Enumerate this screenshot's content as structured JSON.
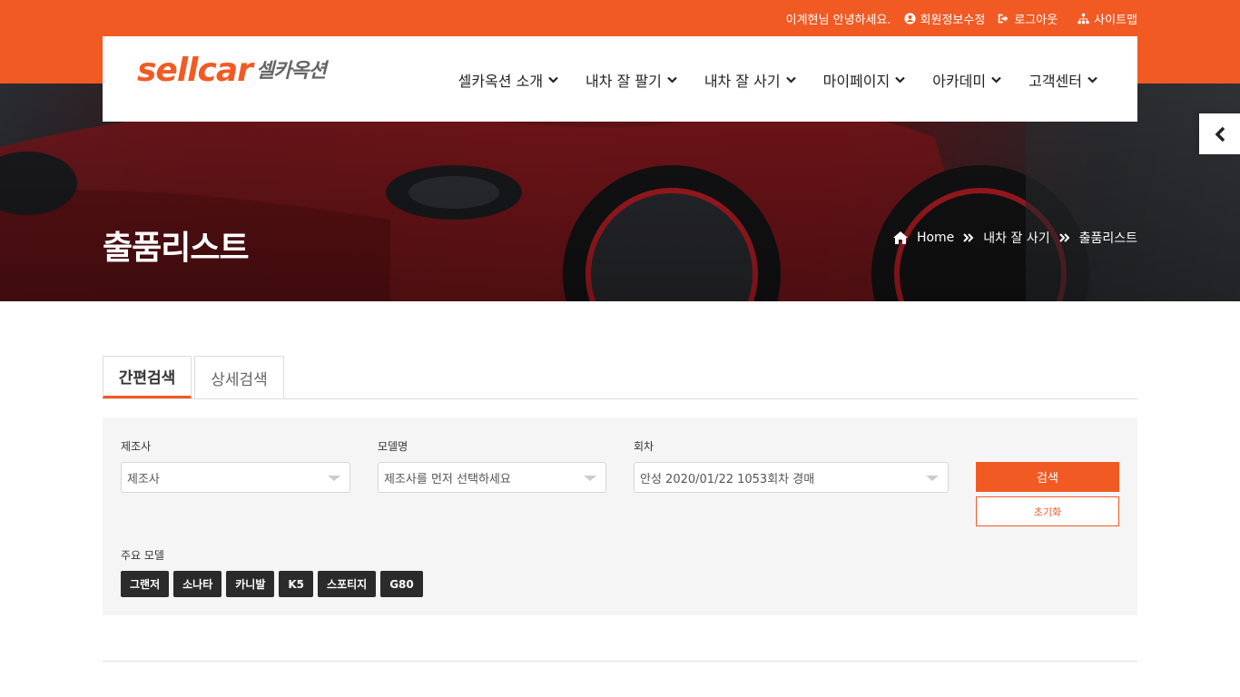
{
  "util": {
    "greeting": "이계현님 안녕하세요.",
    "links": [
      {
        "label": "회원정보수정",
        "icon": "user-circle-icon"
      },
      {
        "label": "로그아웃",
        "icon": "logout-icon"
      },
      {
        "label": "사이트맵",
        "icon": "sitemap-icon"
      }
    ]
  },
  "brand": {
    "logo_en": "sellcar",
    "logo_ko": "셀카옥션",
    "accent": "#f25a24"
  },
  "nav": {
    "items": [
      "셀카옥션 소개",
      "내차 잘 팔기",
      "내차 잘 사기",
      "마이페이지",
      "아카데미",
      "고객센터"
    ]
  },
  "hero": {
    "title": "출품리스트",
    "breadcrumb": [
      "Home",
      "내차 잘 사기",
      "출품리스트"
    ]
  },
  "tabs": {
    "active": "간편검색",
    "inactive": "상세검색"
  },
  "search": {
    "maker_label": "제조사",
    "maker_value": "제조사",
    "model_label": "모델명",
    "model_value": "제조사를 먼저 선택하세요",
    "round_label": "회차",
    "round_value": "안성 2020/01/22 1053회차 경매",
    "search_button": "검색",
    "reset_button": "초기화",
    "popular_label": "주요 모델",
    "popular_models": [
      "그랜저",
      "소나타",
      "카니발",
      "K5",
      "스포티지",
      "G80"
    ]
  }
}
